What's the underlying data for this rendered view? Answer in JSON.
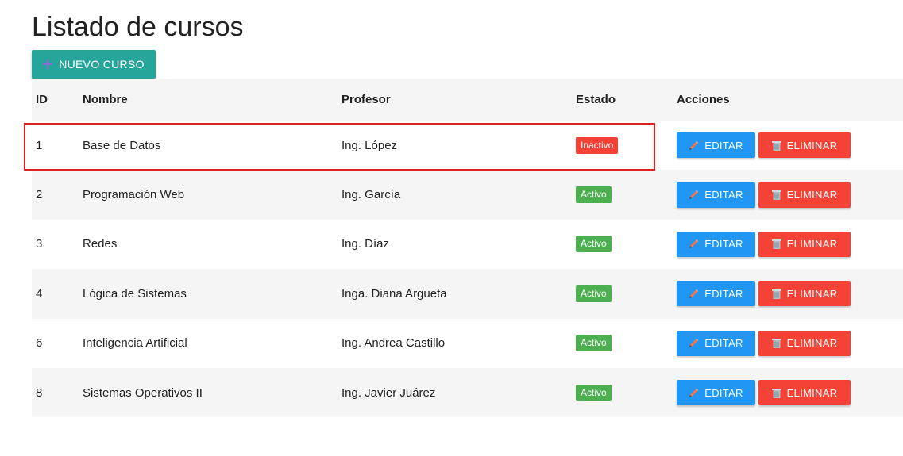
{
  "page": {
    "title": "Listado de cursos",
    "new_button_label": "NUEVO CURSO"
  },
  "table": {
    "headers": {
      "id": "ID",
      "name": "Nombre",
      "professor": "Profesor",
      "state": "Estado",
      "actions": "Acciones"
    },
    "edit_label": "EDITAR",
    "delete_label": "ELIMINAR",
    "rows": [
      {
        "id": "1",
        "name": "Base de Datos",
        "professor": "Ing. López",
        "state": "Inactivo",
        "status": "inactive"
      },
      {
        "id": "2",
        "name": "Programación Web",
        "professor": "Ing. García",
        "state": "Activo",
        "status": "active"
      },
      {
        "id": "3",
        "name": "Redes",
        "professor": "Ing. Díaz",
        "state": "Activo",
        "status": "active"
      },
      {
        "id": "4",
        "name": "Lógica de Sistemas",
        "professor": "Inga. Diana Argueta",
        "state": "Activo",
        "status": "active"
      },
      {
        "id": "6",
        "name": "Inteligencia Artificial",
        "professor": "Ing. Andrea Castillo",
        "state": "Activo",
        "status": "active"
      },
      {
        "id": "8",
        "name": "Sistemas Operativos II",
        "professor": "Ing. Javier Juárez",
        "state": "Activo",
        "status": "active"
      }
    ]
  },
  "colors": {
    "primary_teal": "#26a69a",
    "edit_blue": "#2196f3",
    "delete_red": "#f44336",
    "active_green": "#4caf50",
    "inactive_red": "#f44336",
    "highlight_red": "#e02020"
  },
  "icons": {
    "new_button": "plus-icon",
    "edit_button": "pencil-icon",
    "delete_button": "trash-icon"
  }
}
